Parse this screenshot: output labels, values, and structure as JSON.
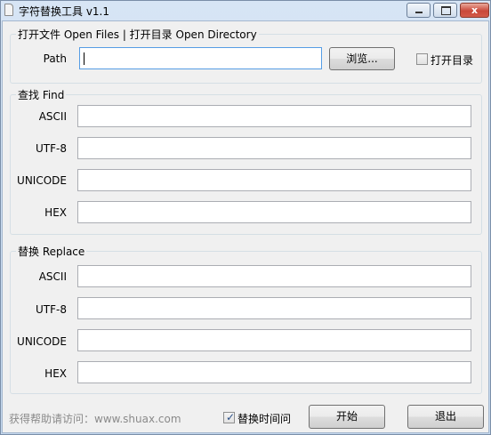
{
  "window": {
    "title": "字符替换工具 v1.1",
    "minimize_icon": "minimize-icon",
    "maximize_icon": "maximize-icon",
    "close_label": "x"
  },
  "open_section": {
    "legend": "打开文件 Open Files | 打开目录 Open Directory",
    "path_label": "Path",
    "path_value": "",
    "browse_button": "浏览...",
    "open_dir_checkbox": {
      "label": "打开目录",
      "checked": false
    }
  },
  "find_section": {
    "legend": "查找 Find",
    "fields": [
      {
        "label": "ASCII",
        "value": ""
      },
      {
        "label": "UTF-8",
        "value": ""
      },
      {
        "label": "UNICODE",
        "value": ""
      },
      {
        "label": "HEX",
        "value": ""
      }
    ]
  },
  "replace_section": {
    "legend": "替换 Replace",
    "fields": [
      {
        "label": "ASCII",
        "value": ""
      },
      {
        "label": "UTF-8",
        "value": ""
      },
      {
        "label": "UNICODE",
        "value": ""
      },
      {
        "label": "HEX",
        "value": ""
      }
    ]
  },
  "footer": {
    "help_text": "获得帮助请访问：www.shuax.com",
    "keep_time_checkbox": {
      "label": "替换时间问",
      "checked": true
    },
    "start_button": "开始",
    "exit_button": "退出"
  }
}
